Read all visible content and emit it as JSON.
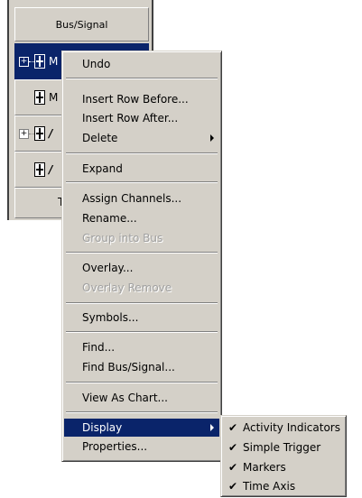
{
  "table": {
    "header": "Bus/Signal",
    "rows": [
      {
        "label": "M",
        "selected": true
      },
      {
        "label": "M",
        "selected": false
      },
      {
        "label": "/",
        "selected": false
      },
      {
        "label": "/",
        "selected": false
      },
      {
        "label": "T",
        "selected": false
      }
    ]
  },
  "menu": {
    "undo": "Undo",
    "insert_row_before": "Insert Row Before...",
    "insert_row_after": "Insert Row After...",
    "delete": "Delete",
    "expand": "Expand",
    "assign_channels": "Assign Channels...",
    "rename": "Rename...",
    "group_into_bus": "Group into Bus",
    "overlay": "Overlay...",
    "overlay_remove": "Overlay Remove",
    "symbols": "Symbols...",
    "find": "Find...",
    "find_bus_signal": "Find Bus/Signal...",
    "view_as_chart": "View As Chart...",
    "display": "Display",
    "properties": "Properties..."
  },
  "submenu": {
    "items": [
      {
        "label": "Activity Indicators",
        "checked": true
      },
      {
        "label": "Simple Trigger",
        "checked": true
      },
      {
        "label": "Markers",
        "checked": true
      },
      {
        "label": "Time Axis",
        "checked": true
      }
    ]
  },
  "icons": {
    "check": "✔",
    "expand_plus": "+"
  },
  "colors": {
    "highlight": "#0a246a",
    "face": "#d4d0c8",
    "disabled_text": "#a0a0a0"
  }
}
